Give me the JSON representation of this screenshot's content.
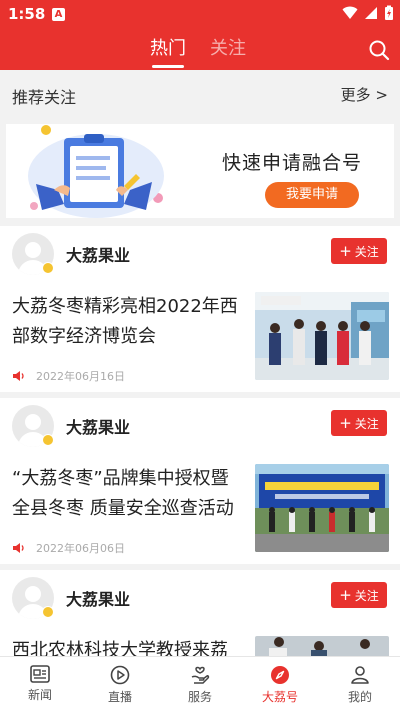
{
  "status_bar": {
    "time": "1:58",
    "notification_badge": "A"
  },
  "header": {
    "tabs": [
      {
        "label": "热门",
        "active": true
      },
      {
        "label": "关注",
        "active": false
      }
    ],
    "accent_color": "#e8322e"
  },
  "recommend": {
    "title": "推荐关注",
    "more_label": "更多 >"
  },
  "banner": {
    "title": "快速申请融合号",
    "button_label": "我要申请",
    "button_color": "#f26a21"
  },
  "feed": {
    "items": [
      {
        "author": "大荔果业",
        "follow_label": "关注",
        "headline": "大荔冬枣精彩亮相2022年西部数字经济博览会",
        "date": "2022年06月16日"
      },
      {
        "author": "大荔果业",
        "follow_label": "关注",
        "headline": "“大荔冬枣”品牌集中授权暨全县冬枣 质量安全巡查活动启…",
        "date": "2022年06月06日"
      },
      {
        "author": "大荔果业",
        "follow_label": "关注",
        "headline": "西北农林科技大学教授来荔调",
        "date": ""
      }
    ]
  },
  "bottom_nav": {
    "items": [
      {
        "label": "新闻",
        "icon": "news-icon",
        "active": false
      },
      {
        "label": "直播",
        "icon": "play-icon",
        "active": false
      },
      {
        "label": "服务",
        "icon": "service-icon",
        "active": false
      },
      {
        "label": "大荔号",
        "icon": "compass-icon",
        "active": true
      },
      {
        "label": "我的",
        "icon": "user-icon",
        "active": false
      }
    ]
  }
}
